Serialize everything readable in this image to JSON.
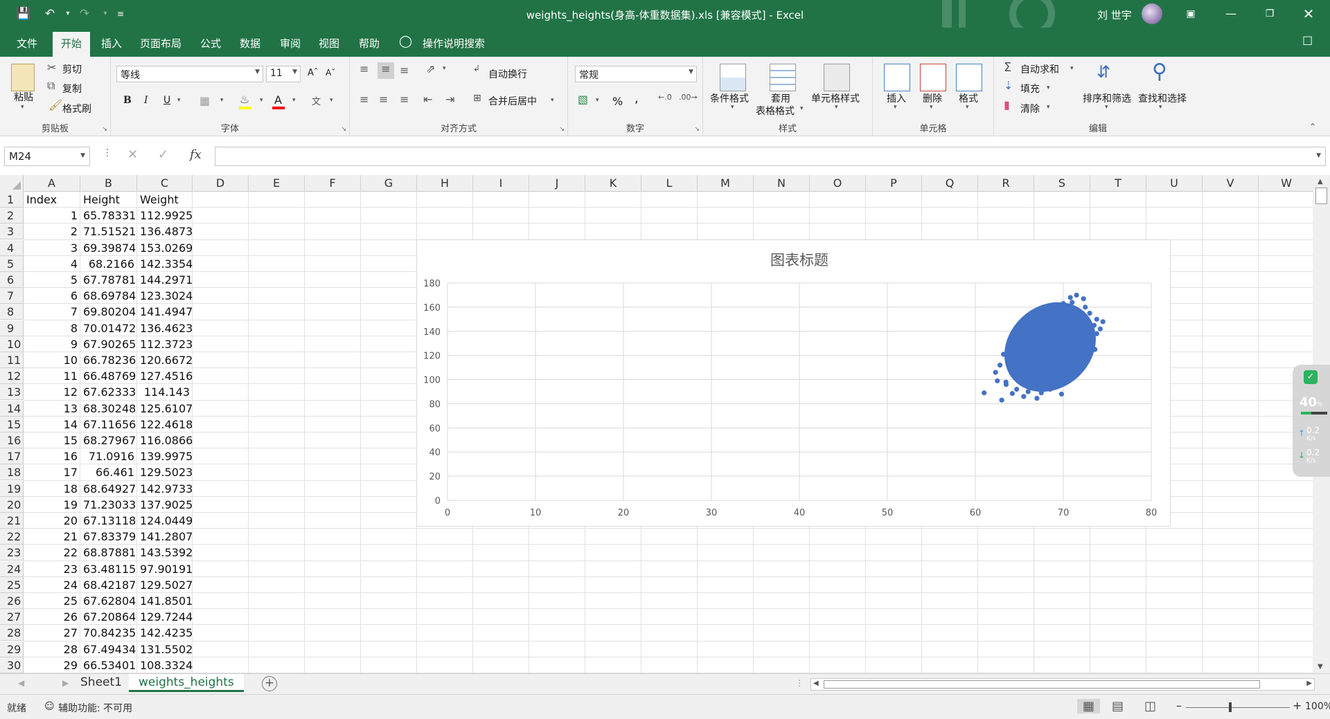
{
  "titlebar": {
    "title": "weights_heights(身高-体重数据集).xls  [兼容模式]  -  Excel",
    "user": "刘 世宇"
  },
  "tabs": [
    "文件",
    "开始",
    "插入",
    "页面布局",
    "公式",
    "数据",
    "审阅",
    "视图",
    "帮助"
  ],
  "tell_me": "操作说明搜索",
  "ribbon": {
    "clipboard": {
      "paste": "粘贴",
      "cut": "剪切",
      "copy": "复制",
      "format_painter": "格式刷",
      "label": "剪贴板"
    },
    "font": {
      "name": "等线",
      "size": "11",
      "bold": "B",
      "italic": "I",
      "underline": "U",
      "label": "字体"
    },
    "alignment": {
      "wrap": "自动换行",
      "merge": "合并后居中",
      "label": "对齐方式"
    },
    "number": {
      "format": "常规",
      "percent": "%",
      "comma": ",",
      "label": "数字"
    },
    "styles": {
      "conditional": "条件格式",
      "table": "套用",
      "table2": "表格格式",
      "cell_styles": "单元格样式",
      "label": "样式"
    },
    "cells": {
      "insert": "插入",
      "delete": "删除",
      "format": "格式",
      "label": "单元格"
    },
    "editing": {
      "autosum": "自动求和",
      "fill": "填充",
      "clear": "清除",
      "sort": "排序和筛选",
      "find": "查找和选择",
      "label": "编辑"
    }
  },
  "formula_bar": {
    "name_box": "M24",
    "fx": "fx",
    "formula": ""
  },
  "columns": [
    "A",
    "B",
    "C",
    "D",
    "E",
    "F",
    "G",
    "H",
    "I",
    "J",
    "K",
    "L",
    "M",
    "N",
    "O",
    "P",
    "Q",
    "R",
    "S",
    "T",
    "U",
    "V",
    "W"
  ],
  "header_row": [
    "Index",
    "Height",
    "Weight"
  ],
  "rows": [
    [
      "1",
      "65.78331",
      "112.9925"
    ],
    [
      "2",
      "71.51521",
      "136.4873"
    ],
    [
      "3",
      "69.39874",
      "153.0269"
    ],
    [
      "4",
      "68.2166",
      "142.3354"
    ],
    [
      "5",
      "67.78781",
      "144.2971"
    ],
    [
      "6",
      "68.69784",
      "123.3024"
    ],
    [
      "7",
      "69.80204",
      "141.4947"
    ],
    [
      "8",
      "70.01472",
      "136.4623"
    ],
    [
      "9",
      "67.90265",
      "112.3723"
    ],
    [
      "10",
      "66.78236",
      "120.6672"
    ],
    [
      "11",
      "66.48769",
      "127.4516"
    ],
    [
      "12",
      "67.62333",
      "114.143"
    ],
    [
      "13",
      "68.30248",
      "125.6107"
    ],
    [
      "14",
      "67.11656",
      "122.4618"
    ],
    [
      "15",
      "68.27967",
      "116.0866"
    ],
    [
      "16",
      "71.0916",
      "139.9975"
    ],
    [
      "17",
      "66.461",
      "129.5023"
    ],
    [
      "18",
      "68.64927",
      "142.9733"
    ],
    [
      "19",
      "71.23033",
      "137.9025"
    ],
    [
      "20",
      "67.13118",
      "124.0449"
    ],
    [
      "21",
      "67.83379",
      "141.2807"
    ],
    [
      "22",
      "68.87881",
      "143.5392"
    ],
    [
      "23",
      "63.48115",
      "97.90191"
    ],
    [
      "24",
      "68.42187",
      "129.5027"
    ],
    [
      "25",
      "67.62804",
      "141.8501"
    ],
    [
      "26",
      "67.20864",
      "129.7244"
    ],
    [
      "27",
      "70.84235",
      "142.4235"
    ],
    [
      "28",
      "67.49434",
      "131.5502"
    ],
    [
      "29",
      "66.53401",
      "108.3324"
    ]
  ],
  "chart_data": {
    "type": "scatter",
    "title": "图表标题",
    "xlim": [
      0,
      80
    ],
    "ylim": [
      0,
      180
    ],
    "xticks": [
      "0",
      "10",
      "20",
      "30",
      "40",
      "50",
      "60",
      "70",
      "80"
    ],
    "yticks": [
      "0",
      "20",
      "40",
      "60",
      "80",
      "100",
      "120",
      "140",
      "160",
      "180"
    ],
    "grid": true,
    "series_color": "#4472c4",
    "cluster": {
      "x_center": 68.5,
      "y_center": 127,
      "x_range": [
        61,
        74
      ],
      "y_range": [
        83,
        170
      ]
    },
    "points": [
      [
        65.78,
        112.99
      ],
      [
        71.52,
        136.49
      ],
      [
        69.4,
        153.03
      ],
      [
        68.22,
        142.34
      ],
      [
        67.79,
        144.3
      ],
      [
        68.7,
        123.3
      ],
      [
        69.8,
        141.49
      ],
      [
        70.01,
        136.46
      ],
      [
        67.9,
        112.37
      ],
      [
        66.78,
        120.67
      ],
      [
        66.49,
        127.45
      ],
      [
        67.62,
        114.14
      ],
      [
        68.3,
        125.61
      ],
      [
        67.12,
        122.46
      ],
      [
        68.28,
        116.09
      ],
      [
        71.09,
        140.0
      ],
      [
        66.46,
        129.5
      ],
      [
        68.65,
        142.97
      ],
      [
        71.23,
        137.9
      ],
      [
        67.13,
        124.04
      ],
      [
        67.83,
        141.28
      ],
      [
        68.88,
        143.54
      ],
      [
        63.48,
        97.9
      ],
      [
        68.42,
        129.5
      ],
      [
        67.63,
        141.85
      ],
      [
        67.21,
        129.72
      ],
      [
        70.84,
        142.42
      ],
      [
        67.49,
        131.55
      ],
      [
        66.53,
        108.33
      ],
      [
        61.0,
        89.0
      ],
      [
        63.0,
        83.0
      ],
      [
        64.2,
        88.5
      ],
      [
        65.5,
        86.0
      ],
      [
        67.0,
        84.5
      ],
      [
        63.5,
        96.0
      ],
      [
        62.5,
        99.0
      ],
      [
        62.3,
        106.0
      ],
      [
        62.8,
        112.0
      ],
      [
        63.2,
        121.0
      ],
      [
        64.0,
        130.0
      ],
      [
        64.5,
        135.0
      ],
      [
        65.5,
        141.0
      ],
      [
        66.5,
        150.0
      ],
      [
        67.5,
        155.0
      ],
      [
        68.8,
        160.0
      ],
      [
        70.0,
        163.0
      ],
      [
        71.0,
        164.0
      ],
      [
        72.3,
        167.0
      ],
      [
        71.5,
        170.0
      ],
      [
        70.8,
        168.0
      ],
      [
        73.0,
        155.0
      ],
      [
        73.8,
        150.0
      ],
      [
        74.5,
        148.0
      ],
      [
        73.5,
        145.0
      ],
      [
        73.8,
        138.0
      ],
      [
        73.2,
        130.0
      ],
      [
        73.6,
        125.0
      ],
      [
        72.8,
        120.0
      ],
      [
        72.0,
        112.0
      ],
      [
        71.3,
        105.0
      ],
      [
        70.8,
        100.0
      ],
      [
        69.5,
        95.0
      ],
      [
        68.5,
        92.0
      ],
      [
        67.5,
        89.0
      ],
      [
        66.0,
        90.0
      ],
      [
        64.7,
        92.0
      ],
      [
        69.8,
        88.0
      ],
      [
        74.2,
        142.0
      ],
      [
        72.5,
        160.0
      ],
      [
        69.5,
        158.0
      ]
    ]
  },
  "sheets": [
    "Sheet1",
    "weights_heights"
  ],
  "active_sheet": 1,
  "status": {
    "ready": "就绪",
    "accessibility": "辅助功能: 不可用",
    "zoom": "100%"
  },
  "widget": {
    "percent": "40",
    "unit": "%",
    "up": "0.2",
    "down": "0.2",
    "speed_unit": "K/s"
  }
}
